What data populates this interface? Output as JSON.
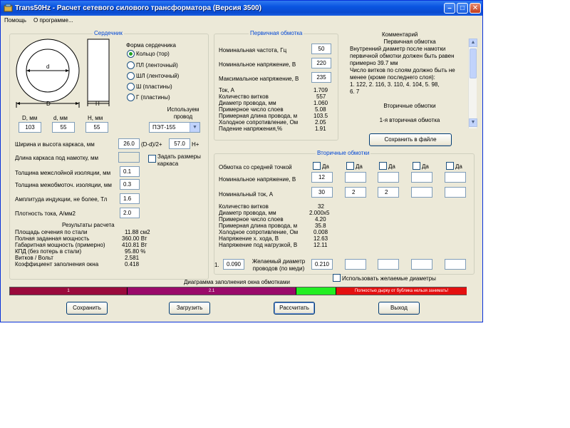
{
  "window": {
    "title": "Trans50Hz - Расчет сетевого силового трансформатора (Версия 3500)"
  },
  "menu": {
    "items": [
      "Помощь",
      "О программе..."
    ]
  },
  "core": {
    "group_title": "Сердечник",
    "diagram": {
      "d_label": "d",
      "D_label": "D",
      "H_label": "H"
    },
    "dims": {
      "D_label": "D, мм",
      "d_label": "d, мм",
      "H_label": "H, мм",
      "D_value": "103",
      "d_value": "55",
      "H_value": "55"
    },
    "shape_label": "Форма сердечника",
    "shapes": [
      "Кольцо  (тор)",
      "ПЛ  (ленточный)",
      "ШЛ  (ленточный)",
      "Ш  (пластины)",
      "Г (пластины)"
    ],
    "selected_shape": 0,
    "wire_label": "Используем провод",
    "wire_value": "ПЭТ-155",
    "params": [
      {
        "label": "Ширина и высота каркаса, мм",
        "v1": "26.0",
        "mid": "(D-d)/2+",
        "v2": "57.0",
        "suffix": "H+"
      },
      {
        "label": "Длина каркаса под намотку, мм",
        "value": ""
      },
      {
        "label": "Толщина межслойной изоляции, мм",
        "value": "0.1"
      },
      {
        "label": "Толщина межобмоточ. изоляции, мм",
        "value": "0.3"
      },
      {
        "label": "Амплитуда индукции, не более, Тл",
        "value": "1.6"
      },
      {
        "label": "Плотность тока, А/мм2",
        "value": "2.0"
      }
    ],
    "frame_checkbox_label": "Задать размеры каркаса",
    "results_title": "Результаты расчета",
    "results": [
      {
        "label": "Площадь сечения по стали",
        "value": "11.88 см2"
      },
      {
        "label": "Полная заданная мощность",
        "value": "360.00 Вт"
      },
      {
        "label": "Габаритная мощность (примерно)",
        "value": "410.81 Вт"
      },
      {
        "label": "КПД (без потерь в стали)",
        "value": "95.80 %"
      },
      {
        "label": "Витков / Вольт",
        "value": "2.581"
      },
      {
        "label": "Коэффициент заполнения окна",
        "value": "0.418"
      }
    ]
  },
  "primary": {
    "group_title": "Первичная обмотка",
    "inputs": [
      {
        "label": "Номинальная частота, Гц",
        "value": "50"
      },
      {
        "label": "Номинальное напряжение, В",
        "value": "220"
      },
      {
        "label": "Максимальное напряжение, В",
        "value": "235"
      }
    ],
    "results": [
      {
        "label": "Ток, А",
        "value": "1.709"
      },
      {
        "label": "Количество витков",
        "value": "557"
      },
      {
        "label": "Диаметр провода, мм",
        "value": "1.060"
      },
      {
        "label": "Примерное число слоев",
        "value": "5.08"
      },
      {
        "label": "Примерная длина провода, м",
        "value": "103.5"
      },
      {
        "label": "Холодное сопротивление, Ом",
        "value": "2.05"
      },
      {
        "label": "Падение напряжения,%",
        "value": "1.91"
      }
    ]
  },
  "comment": {
    "title": "Комментарий",
    "lines": [
      "Первичная обмотка",
      "Внутренний диаметр после намотки",
      "первичной обмотки должен быть равен",
      "примерно 39.7 мм",
      "Число витков по слоям должно быть не",
      "менее (кроме последнего слоя):",
      "1. 122, 2. 116, 3. 110, 4. 104, 5. 98,",
      "6. 7",
      "",
      "Вторичные обмотки",
      "",
      "1-я вторичная обмотка"
    ],
    "save_file_button": "Сохранить в файле"
  },
  "secondary": {
    "group_title": "Вторичные обмотки",
    "midpoint_label": "Обмотка со средней точкой",
    "yes_label": "Да",
    "voltage_label": "Номинальное напряжение, В",
    "current_label": "Номинальный ток, А",
    "voltages": [
      "12",
      "",
      "",
      "",
      ""
    ],
    "currents": [
      "30",
      "2",
      "2",
      "",
      ""
    ],
    "results": [
      {
        "label": "Количество витков",
        "value": "32"
      },
      {
        "label": "Диаметр провода, мм",
        "value": "2.000x5"
      },
      {
        "label": "Примерное число слоев",
        "value": "4.20"
      },
      {
        "label": "Примерная длина провода, м",
        "value": "35.8"
      },
      {
        "label": "Холодное сопротивление, Ом",
        "value": "0.008"
      },
      {
        "label": "Напряжение х. хода, В",
        "value": "12.63"
      },
      {
        "label": "Напряжение под нагрузкой, В",
        "value": "12.11"
      }
    ],
    "desired_index": "1.",
    "desired_first": "0.090",
    "desired_label": "Желаемый диаметр проводов  (по меди)",
    "desired_values": [
      "0.210",
      "",
      "",
      "",
      ""
    ],
    "use_desired_label": "Использовать желаемые диаметры"
  },
  "fill_diagram": {
    "title": "Диаграмма заполнения окна обмотками",
    "segments": [
      {
        "label": "1",
        "fraction": 0.256,
        "color": "#9a0a3c"
      },
      {
        "label": "2.1",
        "fraction": 0.37,
        "color": "#9a0a6a"
      },
      {
        "label": "",
        "fraction": 0.087,
        "color": "#22ee22"
      },
      {
        "label": "Полностью дырку от бублика нельзя занимать!",
        "fraction": 0.287,
        "color": "#e41010"
      }
    ]
  },
  "buttons": {
    "save": "Сохранить",
    "load": "Загрузить",
    "calculate": "Рассчитать",
    "exit": "Выход"
  },
  "colors": {
    "title_bar": "#0a54e0",
    "window_bg": "#ece9d8",
    "group_title": "#0046d5"
  }
}
